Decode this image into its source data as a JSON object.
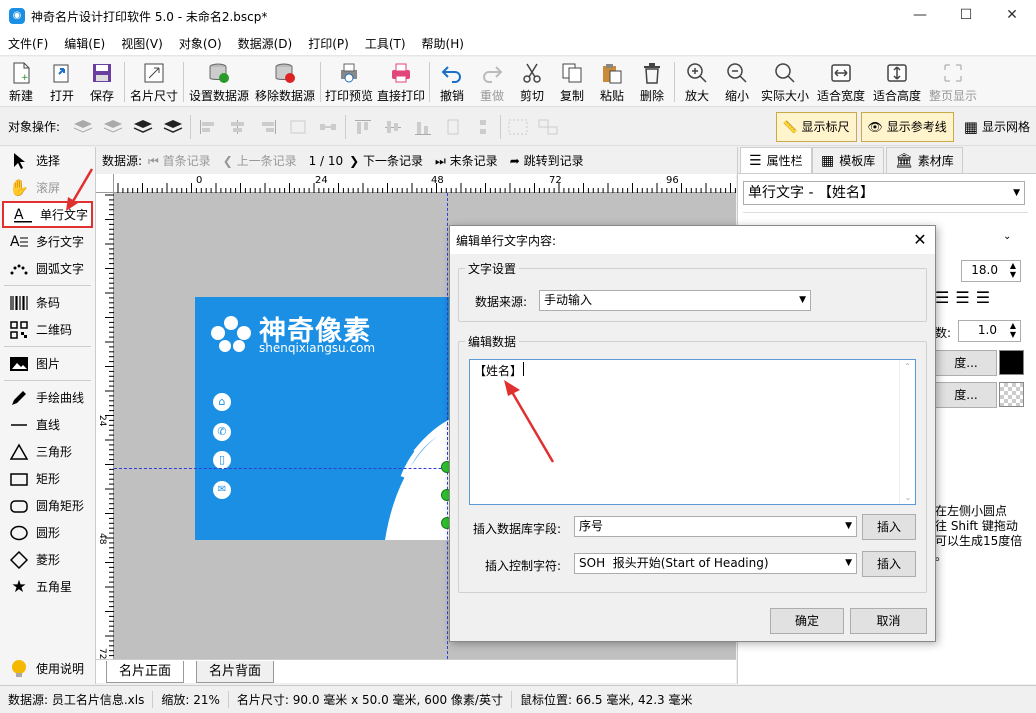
{
  "window": {
    "title": "神奇名片设计打印软件 5.0 - 未命名2.bscp*",
    "app_icon": "app-icon"
  },
  "menu": [
    "文件(F)",
    "编辑(E)",
    "视图(V)",
    "对象(O)",
    "数据源(D)",
    "打印(P)",
    "工具(T)",
    "帮助(H)"
  ],
  "toolbar": {
    "new": "新建",
    "open": "打开",
    "save": "保存",
    "card_size": "名片尺寸",
    "set_ds": "设置数据源",
    "remove_ds": "移除数据源",
    "print_preview": "打印预览",
    "direct_print": "直接打印",
    "undo": "撤销",
    "redo": "重做",
    "cut": "剪切",
    "copy": "复制",
    "paste": "粘贴",
    "delete": "删除",
    "zoom_in": "放大",
    "zoom_out": "缩小",
    "actual_size": "实际大小",
    "fit_width": "适合宽度",
    "fit_height": "适合高度",
    "full_page": "整页显示"
  },
  "toolbar2": {
    "label": "对象操作:",
    "show_ruler": "显示标尺",
    "show_guides": "显示参考线",
    "show_grid": "显示网格"
  },
  "left_tools": {
    "select": "选择",
    "pan": "滚屏",
    "single_text": "单行文字",
    "multi_text": "多行文字",
    "arc_text": "圆弧文字",
    "barcode": "条码",
    "qrcode": "二维码",
    "image": "图片",
    "freehand": "手绘曲线",
    "line": "直线",
    "triangle": "三角形",
    "rect": "矩形",
    "round_rect": "圆角矩形",
    "circle": "圆形",
    "diamond": "菱形",
    "star": "五角星",
    "help": "使用说明"
  },
  "navbar": {
    "label": "数据源:",
    "first": "首条记录",
    "prev": "上一条记录",
    "count": "1 / 10",
    "next": "下一条记录",
    "last": "末条记录",
    "goto": "跳转到记录"
  },
  "ruler": {
    "h_ticks": [
      "0",
      "24",
      "48",
      "72",
      "96"
    ],
    "v_ticks": [
      "24",
      "48",
      "72"
    ]
  },
  "card": {
    "brand": "神奇像素",
    "url": "shenqixiangsu.com"
  },
  "page_tabs": {
    "front": "名片正面",
    "back": "名片背面"
  },
  "right_panel": {
    "tabs": [
      "属性栏",
      "模板库",
      "素材库"
    ],
    "object_select": "单行文字 - 【姓名】",
    "font_size": "18.0",
    "spacing": "1.0",
    "spacing_label": "数:",
    "color_btn1": "度...",
    "color_btn2": "度...",
    "hint": "在左侧小圆点\n往 Shift 键拖动\n可以生成15度倍\n。"
  },
  "dialog": {
    "title": "编辑单行文字内容:",
    "text_settings": "文字设置",
    "ds_label": "数据来源:",
    "ds_value": "手动输入",
    "edit_data": "编辑数据",
    "content": "【姓名】",
    "insert_field_label": "插入数据库字段:",
    "insert_field_value": "序号",
    "insert_ctrl_label": "插入控制字符:",
    "insert_ctrl_value": "SOH  报头开始(Start of Heading)",
    "insert": "插入",
    "insert2": "插入",
    "ok": "确定",
    "cancel": "取消"
  },
  "status": {
    "datasource": "数据源: 员工名片信息.xls",
    "zoom": "缩放: 21%",
    "card_size": "名片尺寸: 90.0 毫米 x 50.0 毫米, 600 像素/英寸",
    "cursor": "鼠标位置: 66.5 毫米, 42.3 毫米"
  },
  "colors": {
    "accent": "#1a8fe3",
    "highlight": "#e03030"
  }
}
